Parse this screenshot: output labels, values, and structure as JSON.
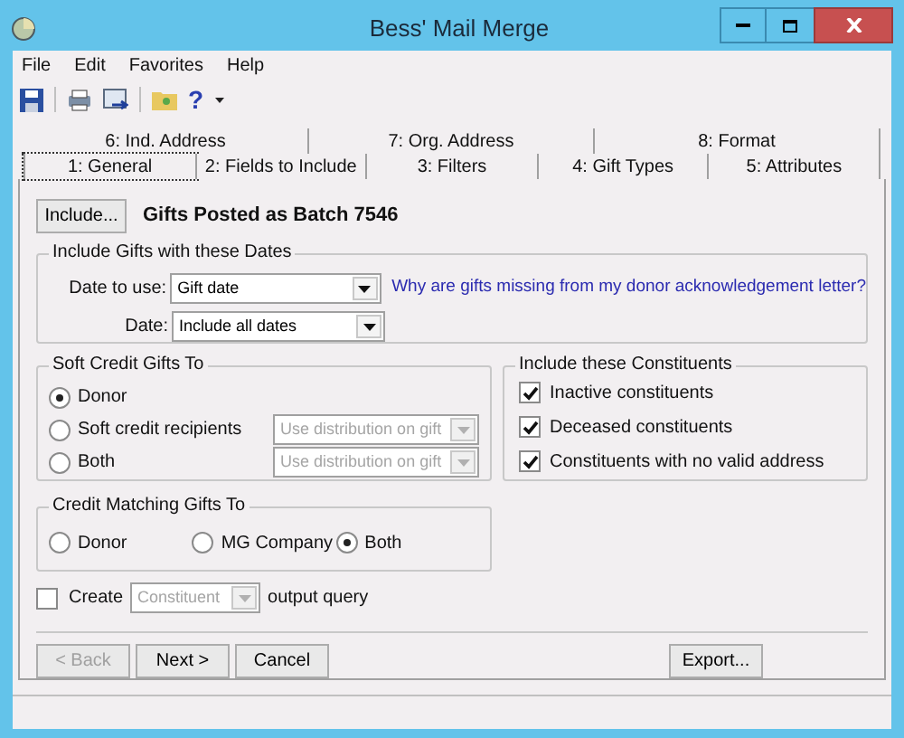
{
  "window": {
    "title": "Bess' Mail Merge"
  },
  "menu": [
    "File",
    "Edit",
    "Favorites",
    "Help"
  ],
  "toolbar": {
    "help_label": "?"
  },
  "tab_rows": [
    [
      {
        "label": "6: Ind. Address",
        "selected": false
      },
      {
        "label": "7: Org. Address",
        "selected": false
      },
      {
        "label": "8: Format",
        "selected": false
      }
    ],
    [
      {
        "label": "1: General",
        "selected": true
      },
      {
        "label": "2: Fields to Include",
        "selected": false
      },
      {
        "label": "3: Filters",
        "selected": false
      },
      {
        "label": "4: Gift Types",
        "selected": false
      },
      {
        "label": "5: Attributes",
        "selected": false
      }
    ]
  ],
  "include_button": "Include...",
  "batch_label": "Gifts Posted as Batch 7546",
  "dates_group": {
    "title": "Include Gifts with these Dates",
    "date_to_use": {
      "label": "Date to use:",
      "value": "Gift date"
    },
    "date": {
      "label": "Date:",
      "value": "Include all dates"
    },
    "help_link": "Why are gifts missing from my donor acknowledgement letter?"
  },
  "soft_credit": {
    "title": "Soft Credit Gifts To",
    "options": [
      {
        "label": "Donor",
        "selected": true
      },
      {
        "label": "Soft credit recipients",
        "selected": false,
        "dropdown": {
          "value": "Use distribution on gift",
          "disabled": true
        }
      },
      {
        "label": "Both",
        "selected": false,
        "dropdown": {
          "value": "Use distribution on gift",
          "disabled": true
        }
      }
    ]
  },
  "constituents": {
    "title": "Include these Constituents",
    "items": [
      {
        "label": "Inactive constituents",
        "checked": true
      },
      {
        "label": "Deceased constituents",
        "checked": true
      },
      {
        "label": "Constituents with no valid address",
        "checked": true
      }
    ]
  },
  "matching": {
    "title": "Credit Matching Gifts To",
    "options": [
      {
        "label": "Donor",
        "selected": false
      },
      {
        "label": "MG Company",
        "selected": false
      },
      {
        "label": "Both",
        "selected": true
      }
    ]
  },
  "output_query": {
    "checked": false,
    "label": "Create",
    "dropdown": {
      "value": "Constituent",
      "disabled": true
    },
    "suffix": "output query"
  },
  "buttons": [
    {
      "label": "< Back",
      "disabled": true
    },
    {
      "label": "Next >",
      "disabled": false
    },
    {
      "label": "Cancel",
      "disabled": false
    }
  ],
  "export_button": {
    "label": "Export...",
    "disabled": false
  }
}
